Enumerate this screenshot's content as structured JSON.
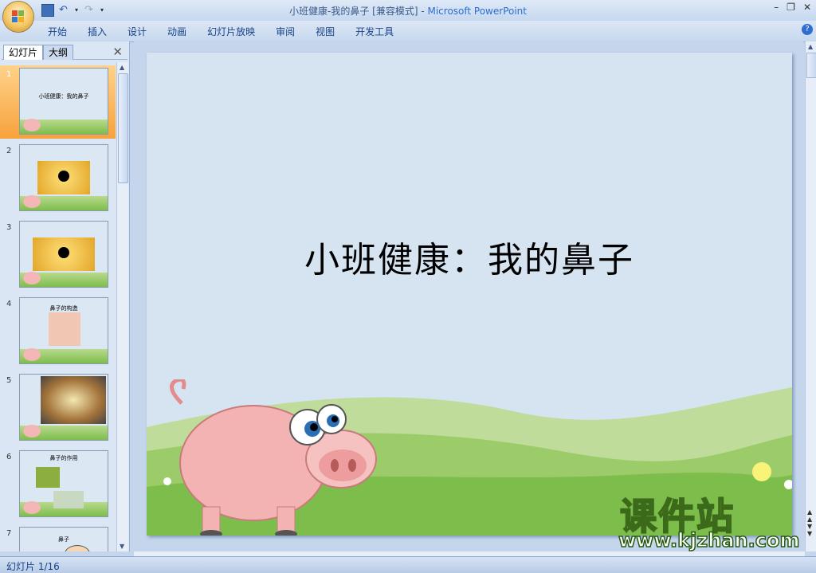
{
  "window": {
    "doc_title": "小班健康-我的鼻子 [兼容模式]",
    "separator": " - ",
    "app_name": "Microsoft PowerPoint",
    "minimize": "–",
    "restore": "❐",
    "close": "✕"
  },
  "ribbon": {
    "tabs": [
      "开始",
      "插入",
      "设计",
      "动画",
      "幻灯片放映",
      "审阅",
      "视图",
      "开发工具"
    ],
    "help": "?"
  },
  "panel": {
    "tab_slides": "幻灯片",
    "tab_outline": "大纲",
    "close": "✕",
    "thumbnails": [
      {
        "number": "1",
        "text": "小班健康：我的鼻子",
        "kind": "title"
      },
      {
        "number": "2",
        "text": "",
        "kind": "mickey"
      },
      {
        "number": "3",
        "text": "",
        "kind": "mickey"
      },
      {
        "number": "4",
        "text": "鼻子的构造",
        "kind": "nose"
      },
      {
        "number": "5",
        "text": "",
        "kind": "food"
      },
      {
        "number": "6",
        "text": "鼻子的作用",
        "kind": "uses"
      },
      {
        "number": "7",
        "text": "鼻子",
        "kind": "face"
      }
    ],
    "selected": 1
  },
  "slide": {
    "title": "小班健康：我的鼻子"
  },
  "status": {
    "slide_indicator": "幻灯片 1/16"
  },
  "watermark": {
    "big": "课件站",
    "url": "www.kjzhan.com"
  },
  "colors": {
    "ribbon_text": "#15428b",
    "selection": "#f7a23c",
    "slide_bg": "#d6e4f1",
    "grass": "#7dbd4b",
    "pig": "#f4b6b6",
    "watermark": "#ffe21a"
  }
}
